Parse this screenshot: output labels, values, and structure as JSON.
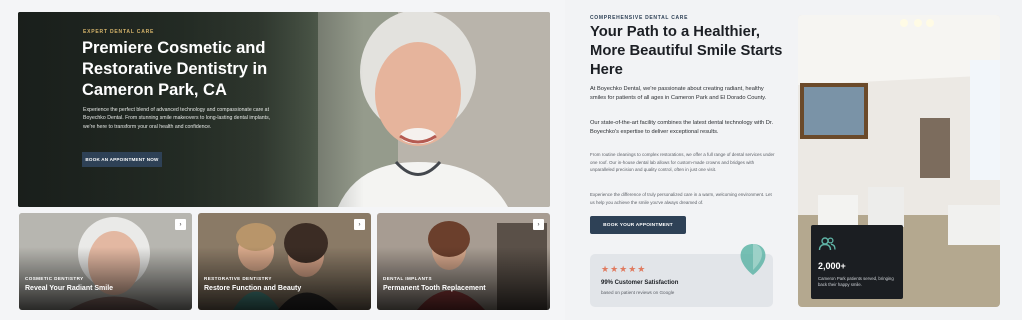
{
  "hero": {
    "eyebrow": "EXPERT DENTAL CARE",
    "title": "Premiere Cosmetic and Restorative Dentistry in Cameron Park, CA",
    "description": "Experience the perfect blend of advanced technology and compassionate care at Boyechko Dental. From stunning smile makeovers to long-lasting dental implants, we're here to transform your oral health and confidence.",
    "button_label": "BOOK AN APPOINTMENT NOW"
  },
  "cards": [
    {
      "category": "COSMETIC DENTISTRY",
      "title": "Reveal Your Radiant Smile",
      "corner_icon": "chevron-icon"
    },
    {
      "category": "RESTORATIVE DENTISTRY",
      "title": "Restore Function and Beauty",
      "corner_icon": "chevron-icon"
    },
    {
      "category": "DENTAL IMPLANTS",
      "title": "Permanent Tooth Replacement",
      "corner_icon": "chevron-icon"
    }
  ],
  "about": {
    "eyebrow": "COMPREHENSIVE DENTAL CARE",
    "title": "Your Path to a Healthier, More Beautiful Smile Starts Here",
    "p1": "At Boyechko Dental, we're passionate about creating radiant, healthy smiles for patients of all ages in Cameron Park and El Dorado County.",
    "p2": "Our state-of-the-art facility combines the latest dental technology with Dr. Boyechko's expertise to deliver exceptional results.",
    "p3": "From routine cleanings to complex restorations, we offer a full range of dental services under one roof. Our in-house dental lab allows for custom-made crowns and bridges with unparalleled precision and quality control, often in just one visit.",
    "p4": "Experience the difference of truly personalized care in a warm, welcoming environment. Let us help you achieve the smile you've always dreamed of.",
    "button_label": "BOOK YOUR APPOINTMENT"
  },
  "rating": {
    "stars": "★★★★★",
    "title": "99% Customer Satisfaction",
    "subtitle": "based on patient reviews on Google",
    "icon": "tooth-location-icon"
  },
  "stat": {
    "icon": "users-icon",
    "number": "2,000+",
    "text": "Cameron Park patients served, bringing back their happy smile."
  },
  "colors": {
    "navy": "#2e4156",
    "gold": "#d4b36a",
    "star": "#e07a5f",
    "teal": "#5fb5a7"
  }
}
